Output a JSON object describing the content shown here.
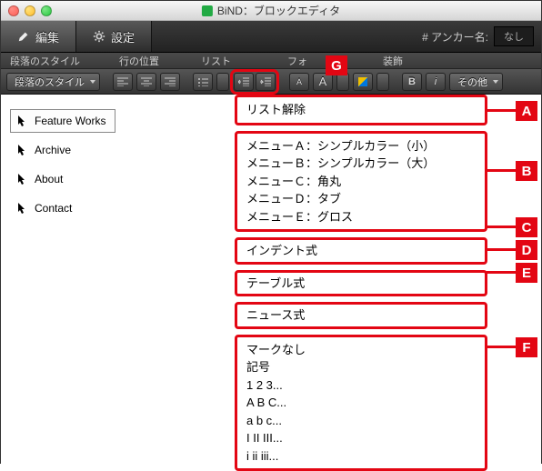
{
  "window": {
    "title": "BiND：ブロックエディタ"
  },
  "tabs": {
    "edit": "編集",
    "settings": "設定"
  },
  "anchor": {
    "label": "# アンカー名:",
    "value": "なし"
  },
  "groups": {
    "para_style": "段落のスタイル",
    "line_pos": "行の位置",
    "list": "リスト",
    "font": "フォ",
    "decor": "装飾"
  },
  "toolbar": {
    "para_style_dd": "段落のスタイル",
    "other": "その他"
  },
  "nav": {
    "items": [
      {
        "label": "Feature Works",
        "active": true
      },
      {
        "label": "Archive",
        "active": false
      },
      {
        "label": "About",
        "active": false
      },
      {
        "label": "Contact",
        "active": false
      }
    ]
  },
  "dropdown": {
    "clear": "リスト解除",
    "menus": [
      "メニューＡ：シンプルカラー（小）",
      "メニューＢ：シンプルカラー（大）",
      "メニューＣ：角丸",
      "メニューＤ：タブ",
      "メニューＥ：グロス"
    ],
    "indent": "インデント式",
    "table": "テーブル式",
    "news": "ニュース式",
    "marks": [
      "マークなし",
      "記号",
      "1 2 3...",
      "A B C...",
      "a b c...",
      "I II III...",
      "i ii iii..."
    ]
  },
  "callouts": {
    "A": "A",
    "B": "B",
    "C": "C",
    "D": "D",
    "E": "E",
    "F": "F",
    "G": "G"
  }
}
